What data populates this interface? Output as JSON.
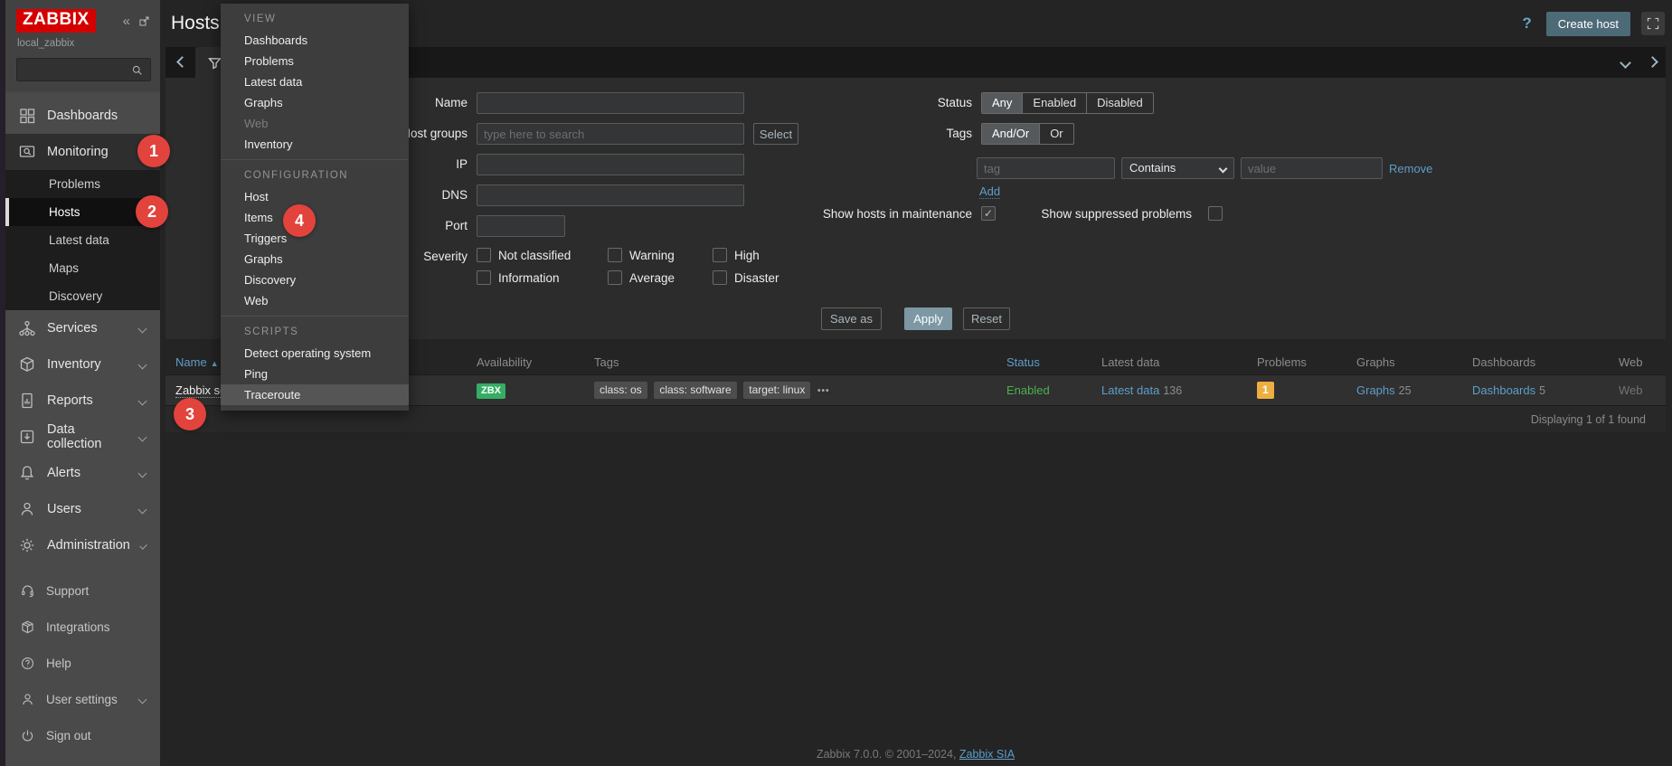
{
  "sidebar": {
    "logo": "ZABBIX",
    "server_name": "local_zabbix",
    "search": {
      "placeholder": ""
    },
    "main_items": [
      {
        "label": "Dashboards"
      },
      {
        "label": "Monitoring",
        "active": true
      },
      {
        "label": "Services",
        "chevron": true
      },
      {
        "label": "Inventory",
        "chevron": true
      },
      {
        "label": "Reports",
        "chevron": true
      },
      {
        "label": "Data collection",
        "chevron": true
      },
      {
        "label": "Alerts",
        "chevron": true
      },
      {
        "label": "Users",
        "chevron": true
      },
      {
        "label": "Administration",
        "chevron": true
      }
    ],
    "monitoring_submenu": [
      {
        "label": "Problems"
      },
      {
        "label": "Hosts",
        "selected": true
      },
      {
        "label": "Latest data"
      },
      {
        "label": "Maps"
      },
      {
        "label": "Discovery"
      }
    ],
    "footer_items": [
      {
        "label": "Support"
      },
      {
        "label": "Integrations"
      },
      {
        "label": "Help"
      },
      {
        "label": "User settings",
        "chevron": true
      },
      {
        "label": "Sign out"
      }
    ]
  },
  "header": {
    "title": "Hosts",
    "help_icon": "?",
    "create_host_label": "Create host"
  },
  "filter": {
    "fields": {
      "name_label": "Name",
      "host_groups_label": "Host groups",
      "host_groups_placeholder": "type here to search",
      "select_button": "Select",
      "ip_label": "IP",
      "dns_label": "DNS",
      "port_label": "Port",
      "severity_label": "Severity",
      "severity_options": [
        "Not classified",
        "Information",
        "Warning",
        "Average",
        "High",
        "Disaster"
      ]
    },
    "status": {
      "label": "Status",
      "options": [
        "Any",
        "Enabled",
        "Disabled"
      ],
      "selected": "Any"
    },
    "tags": {
      "label": "Tags",
      "operators": [
        "And/Or",
        "Or"
      ],
      "selected_operator": "And/Or",
      "tag_placeholder": "tag",
      "match_selected": "Contains",
      "value_placeholder": "value",
      "remove_label": "Remove",
      "add_label": "Add"
    },
    "maintenance_label": "Show hosts in maintenance",
    "maintenance_checked": true,
    "suppressed_label": "Show suppressed problems",
    "suppressed_checked": false,
    "buttons": {
      "save_as": "Save as",
      "apply": "Apply",
      "reset": "Reset"
    }
  },
  "popup_menu": {
    "sections": [
      {
        "title": "VIEW",
        "items": [
          {
            "label": "Dashboards"
          },
          {
            "label": "Problems"
          },
          {
            "label": "Latest data"
          },
          {
            "label": "Graphs"
          },
          {
            "label": "Web",
            "disabled": true
          },
          {
            "label": "Inventory"
          }
        ]
      },
      {
        "title": "CONFIGURATION",
        "items": [
          {
            "label": "Host"
          },
          {
            "label": "Items"
          },
          {
            "label": "Triggers"
          },
          {
            "label": "Graphs"
          },
          {
            "label": "Discovery"
          },
          {
            "label": "Web"
          }
        ]
      },
      {
        "title": "SCRIPTS",
        "items": [
          {
            "label": "Detect operating system"
          },
          {
            "label": "Ping"
          },
          {
            "label": "Traceroute",
            "hover": true
          }
        ]
      }
    ]
  },
  "table": {
    "columns": [
      "Name",
      "Availability",
      "Tags",
      "Status",
      "Latest data",
      "Problems",
      "Graphs",
      "Dashboards",
      "Web"
    ],
    "sort_asc_icon": "▲",
    "row": {
      "name": "Zabbix se",
      "availability": "ZBX",
      "tags": [
        "class: os",
        "class: software",
        "target: linux"
      ],
      "tags_more": "•••",
      "status": "Enabled",
      "latest_data_label": "Latest data",
      "latest_data_count": "136",
      "problems_count": "1",
      "graphs_label": "Graphs",
      "graphs_count": "25",
      "dashboards_label": "Dashboards",
      "dashboards_count": "5",
      "web": "Web"
    },
    "summary": "Displaying 1 of 1 found"
  },
  "annotations": [
    {
      "n": "1"
    },
    {
      "n": "2"
    },
    {
      "n": "3"
    },
    {
      "n": "4"
    }
  ],
  "footer": {
    "text": "Zabbix 7.0.0. © 2001–2024, ",
    "link": "Zabbix SIA"
  },
  "colors": {
    "brand_red": "#d40000",
    "link_blue": "#5e9ec9",
    "enabled_green": "#4caf50",
    "availability_green": "#35ad64",
    "problem_orange": "#efae41",
    "annotation_red": "#e2433c"
  }
}
